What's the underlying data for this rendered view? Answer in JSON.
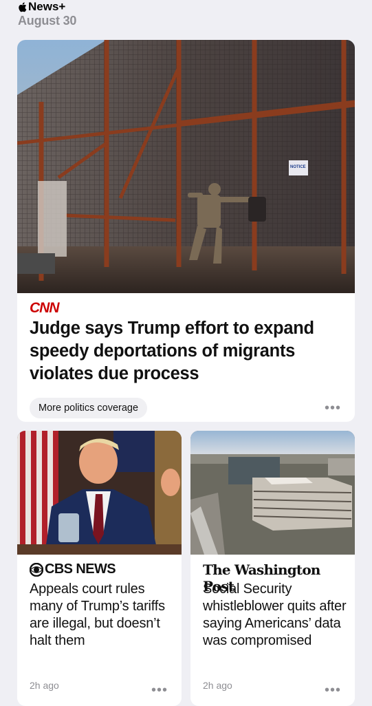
{
  "header": {
    "brand": "News+",
    "date": "August 30"
  },
  "hero": {
    "publisher": "CNN",
    "title": "Judge says Trump effort to expand speedy deportations of migrants violates due process",
    "pill": "More politics coverage",
    "sign_text": "NOTICE"
  },
  "stories": [
    {
      "publisher": "CBS NEWS",
      "title": "Appeals court rules many of Trump’s tariffs are illegal, but doesn’t halt them",
      "time": "2h ago"
    },
    {
      "publisher": "The Washington Post",
      "title": "Social Security whistleblower quits after saying Americans’ data was compromised",
      "time": "2h ago"
    }
  ],
  "more_icon": "ellipsis-icon"
}
